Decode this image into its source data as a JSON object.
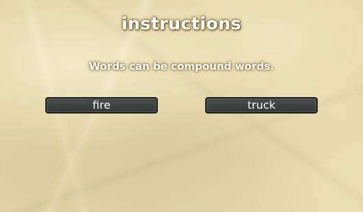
{
  "header": {
    "title": "instructions"
  },
  "instructions": {
    "text": "Words can be compound words."
  },
  "words": {
    "left": "fire",
    "right": "truck"
  },
  "colors": {
    "background": "#e3d4a6",
    "button_fill": "#3f4040",
    "button_border": "#1a1a1a",
    "text": "#ffffff"
  }
}
